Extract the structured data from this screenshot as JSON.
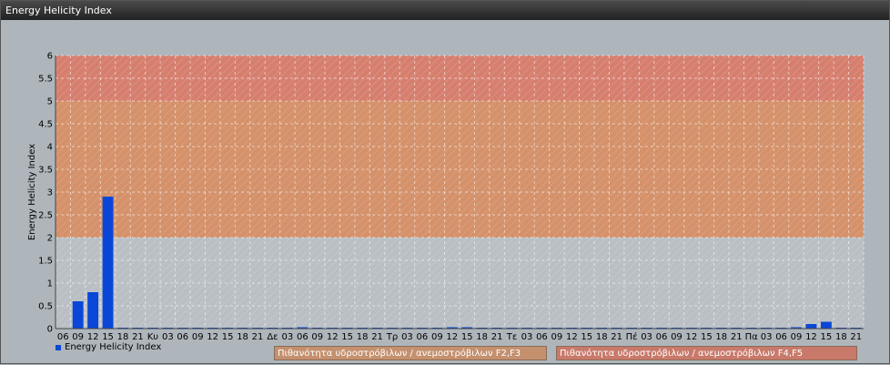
{
  "window": {
    "title": "Energy Helicity Index"
  },
  "chart_data": {
    "type": "bar",
    "ylabel": "Energy Helicity Index",
    "ylim": [
      0,
      6
    ],
    "yticks": [
      "0",
      "0.5",
      "1",
      "1.5",
      "2",
      "2.5",
      "3",
      "3.5",
      "4",
      "4.5",
      "5",
      "5.5",
      "6"
    ],
    "categories": [
      "06",
      "09",
      "12",
      "15",
      "18",
      "21",
      "Κυ",
      "03",
      "06",
      "09",
      "12",
      "15",
      "18",
      "21",
      "Δε",
      "03",
      "06",
      "09",
      "12",
      "15",
      "18",
      "21",
      "Τρ",
      "03",
      "06",
      "09",
      "12",
      "15",
      "18",
      "21",
      "Τε",
      "03",
      "06",
      "09",
      "12",
      "15",
      "18",
      "21",
      "Πέ",
      "03",
      "06",
      "09",
      "12",
      "15",
      "18",
      "21",
      "Πα",
      "03",
      "06",
      "09",
      "12",
      "15",
      "18",
      "21"
    ],
    "series": [
      {
        "name": "Energy Helicity Index",
        "color": "#0a47d8",
        "values": [
          0,
          0.6,
          0.8,
          2.9,
          0.02,
          0.02,
          0.02,
          0.02,
          0.02,
          0.02,
          0.02,
          0.02,
          0.02,
          0.02,
          0.02,
          0.02,
          0.03,
          0.02,
          0.02,
          0.02,
          0.02,
          0.02,
          0.02,
          0.02,
          0.02,
          0.02,
          0.03,
          0.03,
          0.02,
          0.02,
          0.02,
          0.02,
          0.02,
          0.02,
          0.02,
          0.02,
          0.02,
          0.02,
          0.02,
          0.02,
          0.02,
          0.02,
          0.02,
          0.02,
          0.02,
          0.02,
          0.02,
          0.02,
          0.02,
          0.03,
          0.1,
          0.15,
          0.02,
          0.02
        ]
      }
    ],
    "bands": [
      {
        "from": 2,
        "to": 5,
        "color": "#d4916a",
        "label": "Πιθανότητα υδροστρόβιλων / ανεμοστρόβιλων F2,F3"
      },
      {
        "from": 5,
        "to": 6,
        "color": "#d67f6e",
        "label": "Πιθανότητα υδροστρόβιλων / ανεμοστρόβιλων F4,F5"
      }
    ],
    "grid": true,
    "legend": "bottom-left"
  }
}
